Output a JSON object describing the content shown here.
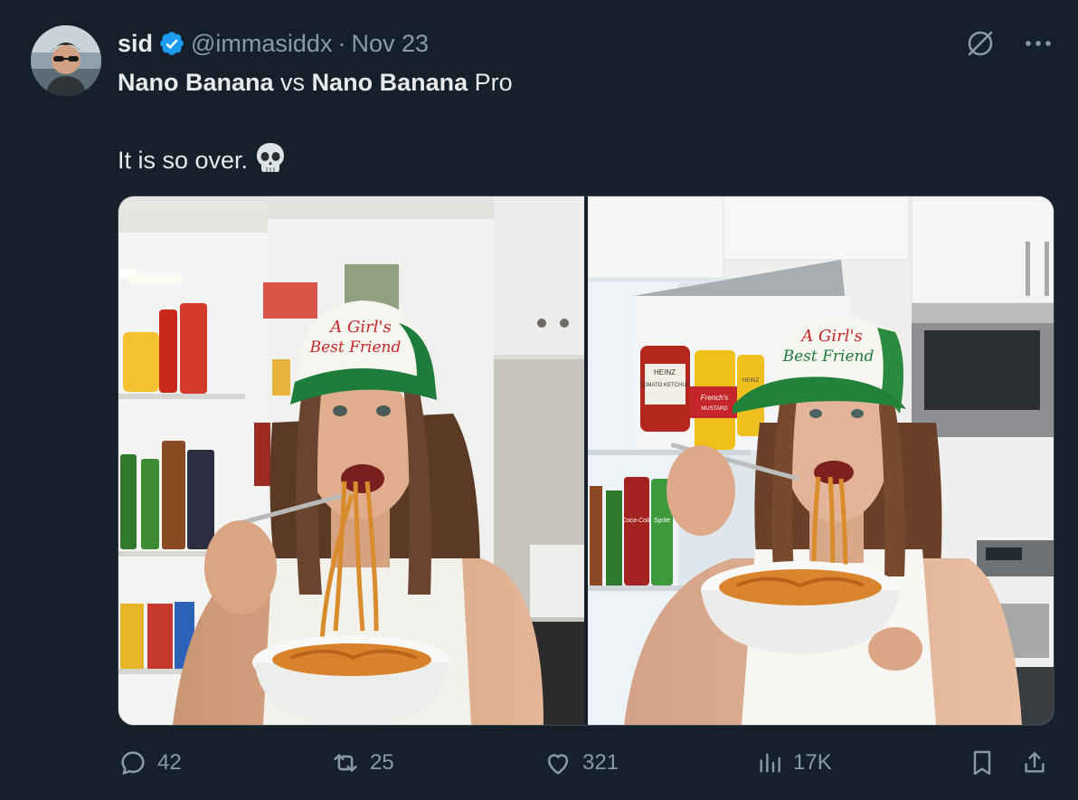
{
  "author": {
    "name": "sid",
    "handle": "@immasiddx",
    "separator": "·",
    "date": "Nov 23"
  },
  "tweet": {
    "line1_part1": "Nano Banana",
    "line1_part2": " vs ",
    "line1_part3": "Nano Banana",
    "line1_part4": " Pro",
    "line2_text": "It is so over.",
    "line2_emoji": "💀"
  },
  "media": {
    "left": {
      "cap_text_line1": "A Girl's",
      "cap_text_line2": "Best Friend",
      "ketchup_label": "",
      "drink_labels": []
    },
    "right": {
      "cap_text_line1": "A Girl's",
      "cap_text_line2": "Best Friend",
      "ketchup_brand": "HEINZ",
      "ketchup_label": "TOMATO KETCHUP",
      "mustard_brand": "French's",
      "mustard_label": "MUSTARD",
      "heinz_small": "HEINZ",
      "cola_label": "Coca-Cola",
      "sprite_label": "Sprite"
    }
  },
  "actions": {
    "replies": "42",
    "reposts": "25",
    "likes": "321",
    "views": "17K"
  },
  "colors": {
    "background": "#15202b",
    "text": "#e7e9ea",
    "muted": "#8b98a5",
    "verified": "#1d9bf0",
    "border": "#38444d"
  },
  "icons": [
    "verified-badge-icon",
    "grok-icon",
    "more-icon",
    "reply-icon",
    "repost-icon",
    "like-icon",
    "views-icon",
    "bookmark-icon",
    "share-icon",
    "skull-emoji"
  ]
}
